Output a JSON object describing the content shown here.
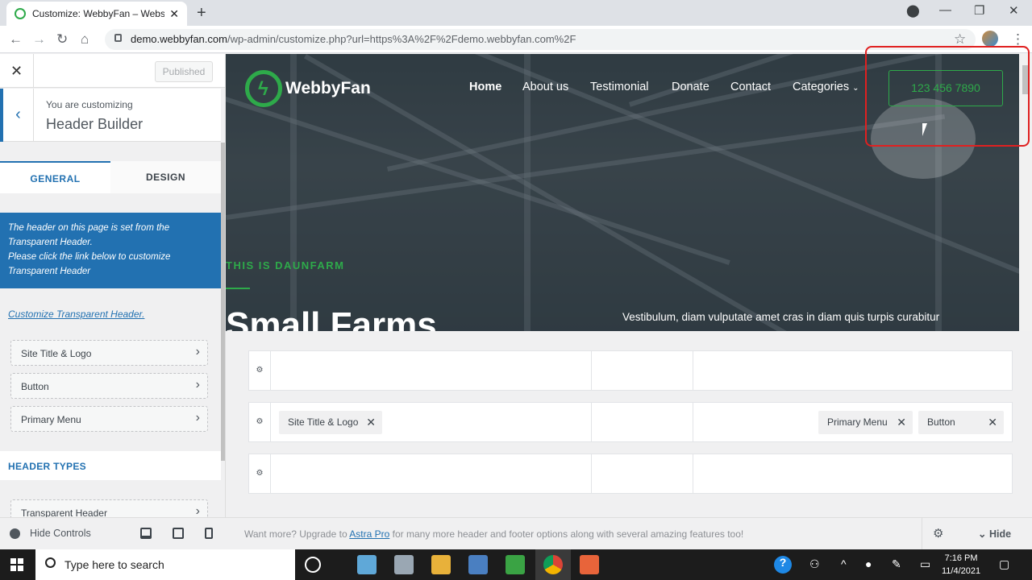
{
  "browser": {
    "tab_title": "Customize: WebbyFan – Website",
    "url_host": "demo.webbyfan.com",
    "url_path": "/wp-admin/customize.php?url=https%3A%2F%2Fdemo.webbyfan.com%2F"
  },
  "sidebar": {
    "published_label": "Published",
    "customizing_small": "You are customizing",
    "customizing_title": "Header Builder",
    "tab_general": "GENERAL",
    "tab_design": "DESIGN",
    "notice_lines": [
      "The header on this page is set from the",
      "Transparent Header.",
      "Please click the link below to customize",
      "Transparent Header"
    ],
    "customize_link": "Customize Transparent Header.",
    "items": [
      "Site Title & Logo",
      "Button",
      "Primary Menu"
    ],
    "header_types_label": "HEADER TYPES",
    "partial_item": "Transparent Header"
  },
  "footer": {
    "hide_controls": "Hide Controls",
    "want_more_pre": "Want more? Upgrade to ",
    "want_more_link": "Astra Pro",
    "want_more_post": " for many more header and footer options along with several amazing features too!",
    "hide_label": "Hide"
  },
  "preview": {
    "logo_text": "WebbyFan",
    "nav": [
      "Home",
      "About us",
      "Testimonial",
      "Donate",
      "Contact",
      "Categories"
    ],
    "phone": "123 456 7890",
    "tagline": "THIS IS DAUNFARM",
    "title": "Small Farms",
    "description": "Vestibulum, diam vulputate amet cras in diam quis turpis curabitur"
  },
  "builder": {
    "row2_chips": [
      "Site Title & Logo",
      "Primary Menu",
      "Button"
    ]
  },
  "taskbar": {
    "search_placeholder": "Type here to search",
    "time": "7:16 PM",
    "date": "11/4/2021"
  },
  "colors": {
    "accent": "#2271b1",
    "brand_green": "#2eaa4a",
    "annotation_red": "#e02020"
  }
}
